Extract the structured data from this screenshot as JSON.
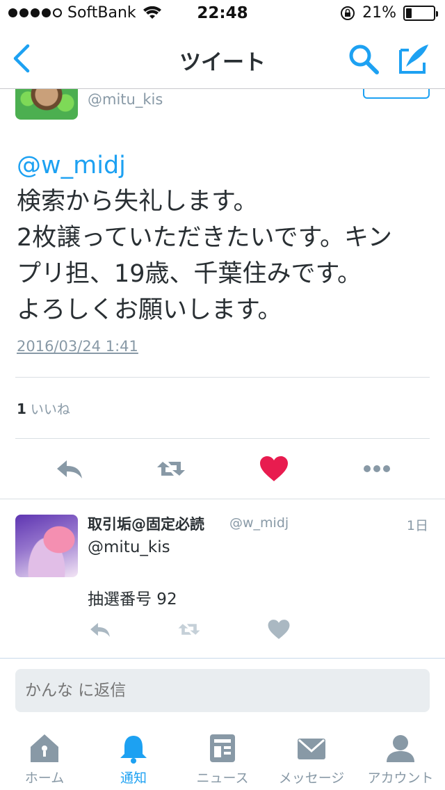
{
  "status_bar": {
    "carrier": "SoftBank",
    "time": "22:48",
    "battery": "21%",
    "battery_level": 0.21,
    "signal_bars": 4
  },
  "nav": {
    "title": "ツイート"
  },
  "tweet": {
    "handle": "@mitu_kis",
    "mention": "@w_midj",
    "lines": [
      "検索から失礼します。",
      "2枚譲っていただきたいです。キン",
      "プリ担、19歳、千葉住みです。",
      "よろしくお願いします。"
    ],
    "timestamp": "2016/03/24 1:41",
    "like_count": "1",
    "like_label": "いいね"
  },
  "reply": {
    "name": "取引垢@固定必読",
    "handle": "@w_midj",
    "time": "1日",
    "mention": "@mitu_kis",
    "text": "抽選番号 92"
  },
  "composer": {
    "placeholder": "かんな に返信"
  },
  "tabs": [
    {
      "label": "ホーム",
      "icon": "home-icon"
    },
    {
      "label": "通知",
      "icon": "bell-icon"
    },
    {
      "label": "ニュース",
      "icon": "news-icon"
    },
    {
      "label": "メッセージ",
      "icon": "envelope-icon"
    },
    {
      "label": "アカウント",
      "icon": "person-icon"
    }
  ],
  "colors": {
    "accent": "#1da1f2",
    "like": "#e81c4f",
    "muted": "#8899a6",
    "text": "#292f33"
  }
}
